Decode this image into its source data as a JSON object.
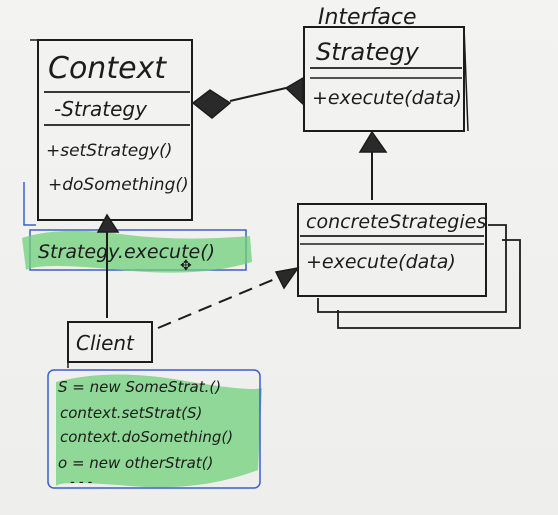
{
  "interface_label": "Interface",
  "strategy_box": {
    "title": "Strategy",
    "method": "+execute(data)"
  },
  "context_box": {
    "title": "Context",
    "field": "-Strategy",
    "methods": [
      "+setStrategy()",
      "+doSomething()"
    ]
  },
  "context_note": "Strategy.execute()",
  "concrete_box": {
    "title": "concreteStrategies",
    "method": "+execute(data)"
  },
  "client_box": {
    "title": "Client"
  },
  "client_note_lines": [
    "S = new SomeStrat.()",
    "context.setStrat(S)",
    "context.doSomething()",
    "o = new otherStrat()",
    "- - -"
  ],
  "colors": {
    "ink": "#1c1c1c",
    "accent": "#d1245a",
    "highlight": "#6fd07a",
    "note_border": "#3a5fd0"
  }
}
